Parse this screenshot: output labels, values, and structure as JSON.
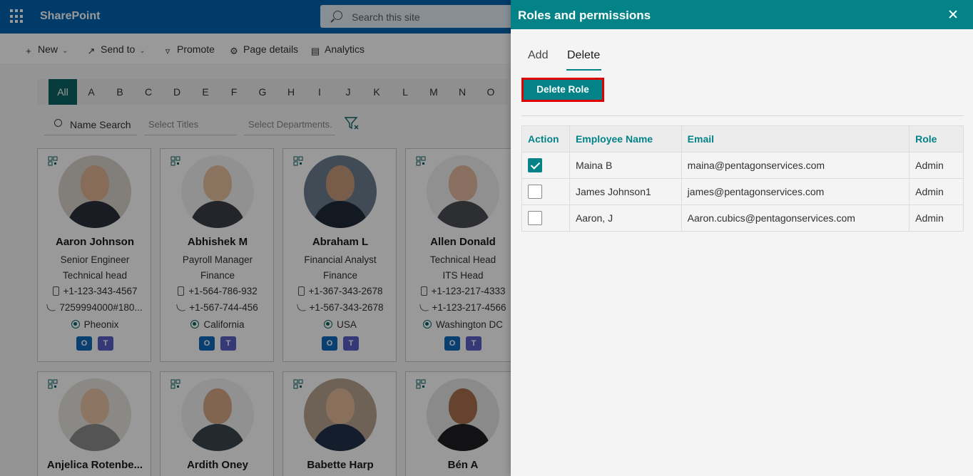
{
  "suite": {
    "brand": "SharePoint",
    "search_placeholder": "Search this site"
  },
  "command_bar": {
    "new": "New",
    "send_to": "Send to",
    "promote": "Promote",
    "page_details": "Page details",
    "analytics": "Analytics"
  },
  "alphabet": [
    "All",
    "A",
    "B",
    "C",
    "D",
    "E",
    "F",
    "G",
    "H",
    "I",
    "J",
    "K",
    "L",
    "M",
    "N",
    "O"
  ],
  "filters": {
    "name_search": "Name Search",
    "titles_placeholder": "Select Titles",
    "departments_placeholder": "Select Departments."
  },
  "employees": [
    {
      "name": "Aaron Johnson",
      "title": "Senior Engineer",
      "department": "Technical head",
      "mobile": "+1-123-343-4567",
      "phone": "7259994000#180...",
      "location": "Pheonix"
    },
    {
      "name": "Abhishek M",
      "title": "Payroll Manager",
      "department": "Finance",
      "mobile": "+1-564-786-932",
      "phone": "+1-567-744-456",
      "location": "California"
    },
    {
      "name": "Abraham L",
      "title": "Financial Analyst",
      "department": "Finance",
      "mobile": "+1-367-343-2678",
      "phone": "+1-567-343-2678",
      "location": "USA"
    },
    {
      "name": "Allen Donald",
      "title": "Technical Head",
      "department": "ITS Head",
      "mobile": "+1-123-217-4333",
      "phone": "+1-123-217-4566",
      "location": "Washington DC"
    },
    {
      "name": "Anjelica Rotenbe..."
    },
    {
      "name": "Ardith Oney"
    },
    {
      "name": "Babette Harp"
    },
    {
      "name": "Bén A"
    }
  ],
  "panel": {
    "title": "Roles and permissions",
    "tabs": {
      "add": "Add",
      "delete": "Delete"
    },
    "delete_button": "Delete Role",
    "table": {
      "headers": {
        "action": "Action",
        "employee_name": "Employee Name",
        "email": "Email",
        "role": "Role"
      },
      "rows": [
        {
          "checked": true,
          "employee_name": "Maina B",
          "email": "maina@pentagonservices.com",
          "role": "Admin"
        },
        {
          "checked": false,
          "employee_name": "James Johnson1",
          "email": "james@pentagonservices.com",
          "role": "Admin"
        },
        {
          "checked": false,
          "employee_name": "Aaron, J",
          "email": "Aaron.cubics@pentagonservices.com",
          "role": "Admin"
        }
      ]
    }
  },
  "colors": {
    "suite_bar": "#0063b1",
    "panel_accent": "#038387",
    "alpha_active": "#0a6464",
    "highlight_border": "#e00000"
  }
}
